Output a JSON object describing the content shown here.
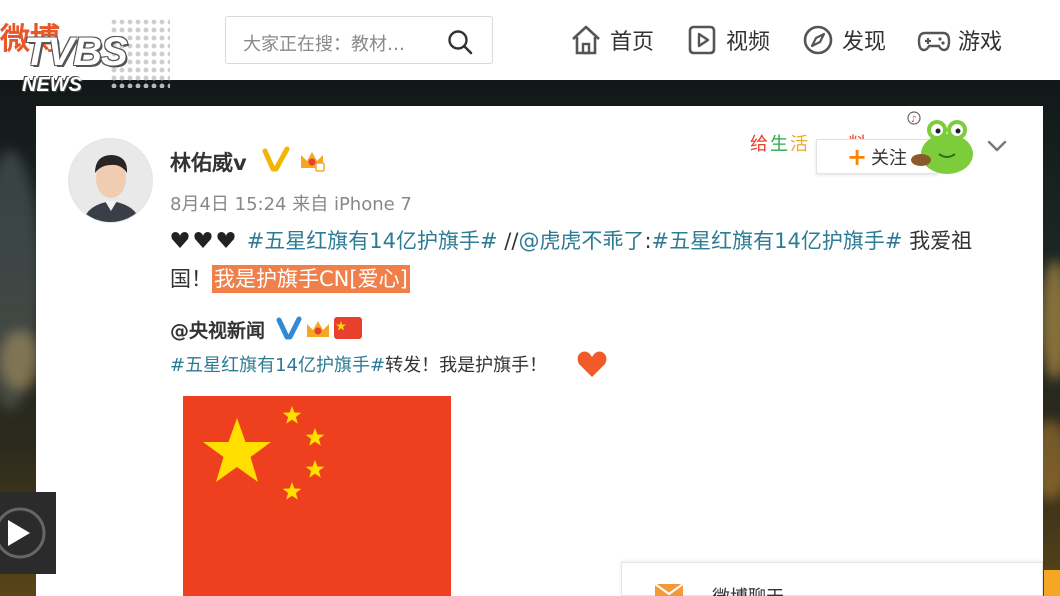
{
  "watermark": {
    "weibo": "微博",
    "brand": "TVBS",
    "sub": "NEWS"
  },
  "search": {
    "placeholder": "大家正在搜：教材…"
  },
  "nav": {
    "items": [
      {
        "label": "首页",
        "icon": "home-icon"
      },
      {
        "label": "视频",
        "icon": "video-icon"
      },
      {
        "label": "发现",
        "icon": "compass-icon"
      },
      {
        "label": "游戏",
        "icon": "gamepad-icon"
      }
    ]
  },
  "post": {
    "author": "林佑威v",
    "meta": "8月4日 15:24 来自 iPhone 7",
    "follow_label": "关注",
    "deco_text": "给生活",
    "text": {
      "hearts": "🖤🖤🖤",
      "topic1": "#五星红旗有14亿护旗手#",
      "sep": " //",
      "mention": "@虎虎不乖了",
      "colon": ":",
      "topic2": "#五星红旗有14亿护旗手#",
      "tail1": " 我爱祖国！",
      "highlight": "我是护旗手CN[爱心]"
    },
    "repost": {
      "author": "@央视新闻",
      "topic": "#五星红旗有14亿护旗手#",
      "text": "转发！我是护旗手！"
    }
  },
  "chat": {
    "label": "微博聊天"
  },
  "colors": {
    "accent": "#ff8200",
    "topic": "#2d7b94",
    "highlight": "#f07f4a",
    "flag_red": "#ee3f1e",
    "flag_star": "#ffde00"
  }
}
